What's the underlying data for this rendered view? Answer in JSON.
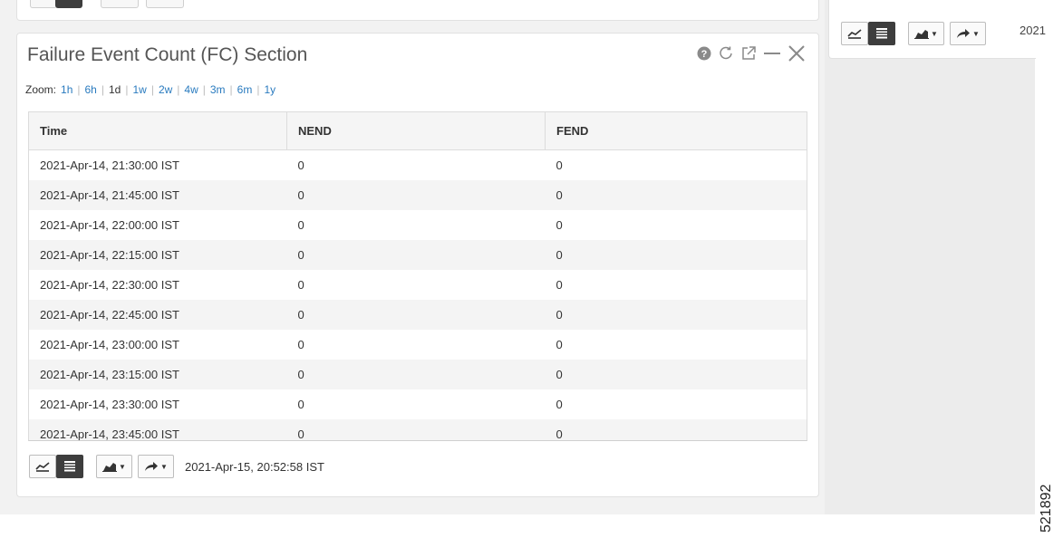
{
  "panel": {
    "title": "Failure Event Count (FC) Section",
    "header_icons": [
      "help-icon",
      "refresh-icon",
      "popout-icon",
      "minimize-icon",
      "close-icon"
    ]
  },
  "zoom": {
    "label": "Zoom:",
    "options": [
      "1h",
      "6h",
      "1d",
      "1w",
      "2w",
      "4w",
      "3m",
      "6m",
      "1y"
    ],
    "selected": "1d"
  },
  "table": {
    "columns": [
      "Time",
      "NEND",
      "FEND"
    ],
    "rows": [
      [
        "2021-Apr-14, 21:30:00 IST",
        "0",
        "0"
      ],
      [
        "2021-Apr-14, 21:45:00 IST",
        "0",
        "0"
      ],
      [
        "2021-Apr-14, 22:00:00 IST",
        "0",
        "0"
      ],
      [
        "2021-Apr-14, 22:15:00 IST",
        "0",
        "0"
      ],
      [
        "2021-Apr-14, 22:30:00 IST",
        "0",
        "0"
      ],
      [
        "2021-Apr-14, 22:45:00 IST",
        "0",
        "0"
      ],
      [
        "2021-Apr-14, 23:00:00 IST",
        "0",
        "0"
      ],
      [
        "2021-Apr-14, 23:15:00 IST",
        "0",
        "0"
      ],
      [
        "2021-Apr-14, 23:30:00 IST",
        "0",
        "0"
      ],
      [
        "2021-Apr-14, 23:45:00 IST",
        "0",
        "0"
      ]
    ]
  },
  "footer": {
    "timestamp": "2021-Apr-15, 20:52:58 IST",
    "buttons": [
      "line-chart-icon",
      "table-view-icon",
      "area-chart-dropdown-icon",
      "share-dropdown-icon"
    ]
  },
  "right_panel": {
    "timestamp_partial": "2021"
  },
  "figure_code": "521892",
  "colors": {
    "link": "#2a7bbf",
    "active_button": "#3d3d3d",
    "row_alt": "#f4f4f4",
    "page_bg": "#f2f2f2"
  }
}
